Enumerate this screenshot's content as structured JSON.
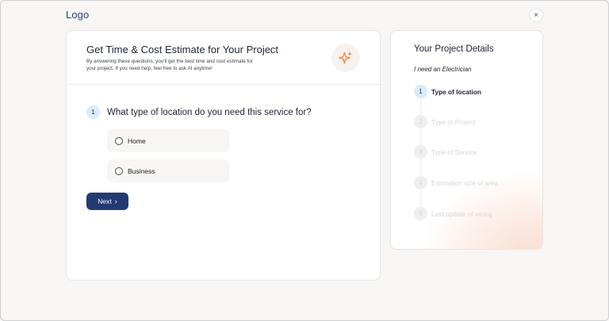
{
  "header": {
    "logo": "Logo",
    "close_symbol": "×"
  },
  "estimate_card": {
    "title": "Get Time & Cost Estimate for Your Project",
    "subtitle": "By answering these questions, you'll get the best time and cost estimate for your project. If you need help, feel free to ask AI anytime!",
    "ai_icon": "sparkle-icon"
  },
  "question": {
    "number": "1",
    "text": "What type of location do you need this service for?",
    "options": [
      {
        "label": "Home"
      },
      {
        "label": "Business"
      }
    ],
    "next_label": "Next",
    "next_chevron": "›"
  },
  "details": {
    "title": "Your Project Details",
    "subtitle": "I need an Electrician",
    "steps": [
      {
        "number": "1",
        "label": "Type of location",
        "state": "active"
      },
      {
        "number": "2",
        "label": "Type of Project",
        "state": "inactive"
      },
      {
        "number": "3",
        "label": "Type of Service",
        "state": "inactive"
      },
      {
        "number": "4",
        "label": "Estimation size of area",
        "state": "inactive"
      },
      {
        "number": "5",
        "label": "Last update of wiring",
        "state": "inactive"
      }
    ]
  },
  "colors": {
    "primary": "#243a73",
    "accent_light": "#d9ecfb",
    "sparkle": "#f08a3c"
  }
}
